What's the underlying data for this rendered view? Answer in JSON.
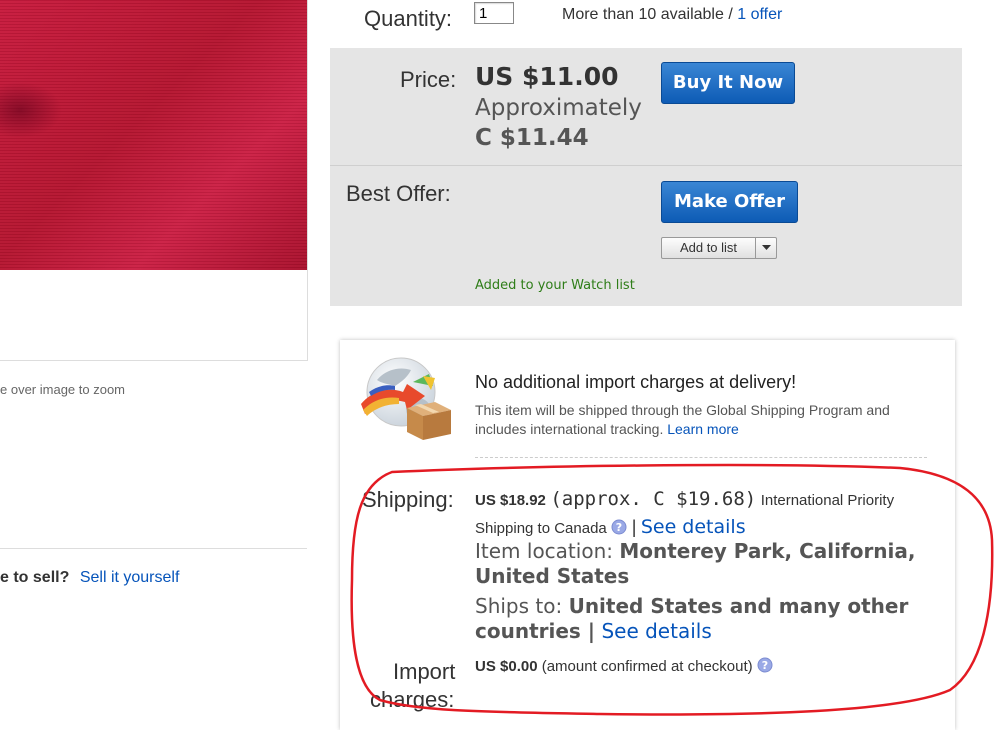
{
  "quantity": {
    "label": "Quantity:",
    "value": "1",
    "availability": "More than 10 available /",
    "offer_link": "1 offer"
  },
  "price": {
    "label": "Price:",
    "amount": "US $11.00",
    "approx_label": "Approximately",
    "converted": "C $11.44",
    "buy_button": "Buy It Now"
  },
  "best_offer": {
    "label": "Best Offer:",
    "make_offer_button": "Make Offer",
    "add_to_list": "Add to list",
    "watch_message": "Added to your Watch list"
  },
  "left": {
    "zoom_hint": "e over image to zoom",
    "sell_question": "e to sell?",
    "sell_link": "Sell it yourself"
  },
  "global_shipping": {
    "title": "No additional import charges at delivery!",
    "description": "This item will be shipped through the Global Shipping Program and includes international tracking.",
    "learn_more": "Learn more"
  },
  "shipping": {
    "label": "Shipping:",
    "cost": "US $18.92",
    "approx": "(approx. C $19.68)",
    "service": "International Priority Shipping to Canada",
    "separator": "|",
    "see_details": "See details",
    "location_label": "Item location:",
    "location_value": "Monterey Park, California, United States",
    "ships_to_label": "Ships to:",
    "ships_to_value": "United States and many other countries |",
    "ships_to_details": "See details"
  },
  "import_charges": {
    "label_line1": "Import",
    "label_line2": "charges:",
    "value": "US $0.00",
    "note": "(amount confirmed at checkout)"
  },
  "colors": {
    "link": "#0654ba",
    "button": "#1565c0",
    "success": "#2e7d18",
    "panel": "#e5e5e5",
    "annotation": "#e31b23",
    "product": "#c41a3c"
  },
  "icons": {
    "globe": "globe-package-icon",
    "help": "help-icon",
    "dropdown": "dropdown-arrow-icon"
  }
}
